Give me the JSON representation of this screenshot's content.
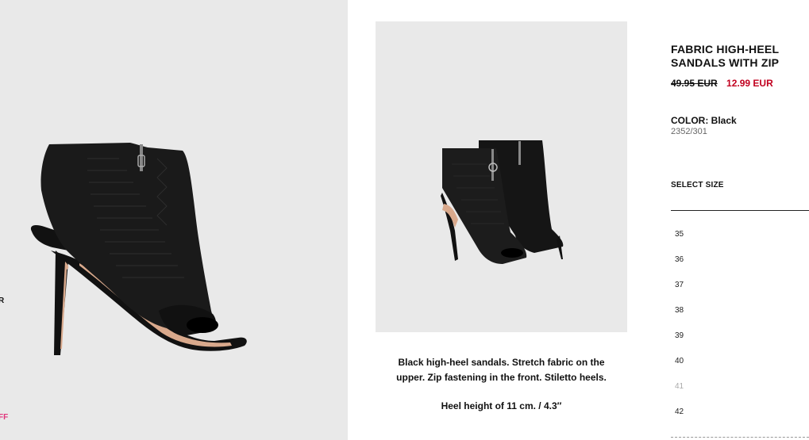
{
  "edge_labels": {
    "partial_r": "R",
    "partial_off": "FF"
  },
  "product": {
    "title_line1": "FABRIC HIGH-HEEL",
    "title_line2": "SANDALS WITH ZIP",
    "old_price": "49.95 EUR",
    "new_price": "12.99 EUR",
    "color_label": "COLOR:",
    "color_value": "Black",
    "reference": "2352/301",
    "select_size_label": "SELECT SIZE",
    "sizes": [
      {
        "label": "35",
        "available": true
      },
      {
        "label": "36",
        "available": true
      },
      {
        "label": "37",
        "available": true
      },
      {
        "label": "38",
        "available": true
      },
      {
        "label": "39",
        "available": true
      },
      {
        "label": "40",
        "available": true
      },
      {
        "label": "41",
        "available": false
      },
      {
        "label": "42",
        "available": true
      }
    ],
    "description_line1": "Black high-heel sandals. Stretch fabric on the",
    "description_line2": "upper. Zip fastening in the front. Stiletto heels.",
    "heel_height": "Heel height of 11 cm. / 4.3″"
  },
  "colors": {
    "panel_bg": "#e9e9e9",
    "sale_price": "#c1001f",
    "off_label": "#e0347a",
    "shoe": "#111111",
    "sole": "#d9a98c"
  }
}
